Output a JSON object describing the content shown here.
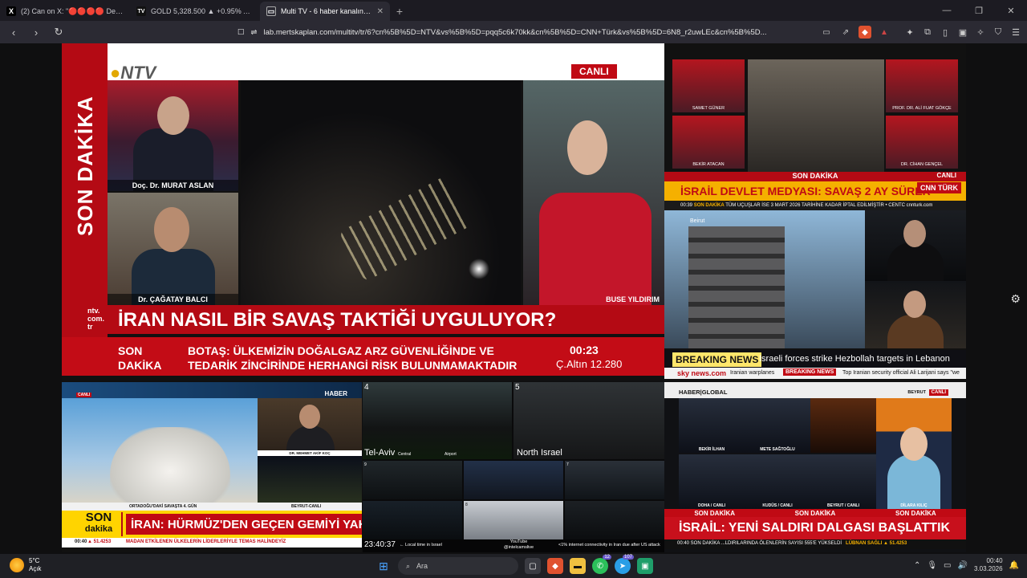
{
  "browser": {
    "tabs": [
      {
        "icon": "X",
        "icon_color": "#000000",
        "title": "(2) Can on X: \"🔴🔴🔴🔴 Devrim"
      },
      {
        "icon": "TV",
        "icon_color": "#1e1e1e",
        "title": "GOLD 5,328.500 ▲ +0.95% Adsız"
      },
      {
        "icon": "▭",
        "icon_color": "#2b2a33",
        "title": "Multi TV - 6 haber kanalını aynı"
      }
    ],
    "url": "lab.mertskaplan.com/multitv/tr/6?cn%5B%5D=NTV&vs%5B%5D=pqq5c6k70kk&cn%5B%5D=CNN+Türk&vs%5B%5D=6N8_r2uwLEc&cn%5B%5D..."
  },
  "ntv": {
    "logo": "NTV",
    "side": "SON DAKİKA",
    "live": "CANLI",
    "guest1": "Doç. Dr. MURAT ASLAN",
    "guest2": "Dr. ÇAĞATAY BALCI",
    "anchor": "BUSE YILDIRIM",
    "site": "ntv.\ncom.\ntr",
    "headline": "İRAN NASIL BİR SAVAŞ TAKTİĞİ UYGULUYOR?",
    "ticker_label": "SON\nDAKİKA",
    "ticker_news": "BOTAŞ: ÜLKEMİZİN DOĞALGAZ ARZ GÜVENLİĞİNDE VE\nTEDARİK ZİNCİRİNDE HERHANGİ RİSK BULUNMAMAKTADIR",
    "time": "00:23",
    "gold": "Ç.Altın 12.280"
  },
  "cnn": {
    "names": [
      "SAMET GÜNER",
      "PROF. DR. ALİ FUAT GÖKÇE",
      "BEKİR ATACAN",
      "DR. CİHAN GENÇEL"
    ],
    "son_dakika": "SON DAKİKA",
    "live": "CANLI",
    "headline": "İSRAİL DEVLET MEDYASI: SAVAŞ 2 AY SÜRER",
    "logo": "CNN TÜRK",
    "ticker_time": "00:39",
    "ticker_label": "SON DAKİKA",
    "ticker_text": "TÜM UÇUŞLAR İSE 3 MART 2026 TARİHİNE KADAR İPTAL EDİLMİŞTİR  •  CENTC  cnnturk.com"
  },
  "sky": {
    "location": "Beirut",
    "breaking": "BREAKING NEWS",
    "headline": "Israeli forces strike Hezbollah targets in Lebanon",
    "logo": "sky news.com",
    "t1": "Iranian warplanes",
    "breaking2": "BREAKING NEWS",
    "t2": "Top Iranian security official Ali Larijani says \"we"
  },
  "hg": {
    "logo": "HABER|GLOBAL",
    "location": "BEYRUT",
    "live": "CANLI",
    "cells": [
      "BEKİR İLHAN",
      "METE SAĞTOĞLU",
      "",
      "DİLARA KILIÇ",
      "DOHA / CANLI",
      "KUDÜS / CANLI",
      "BEYRUT / CANLI",
      ""
    ],
    "son_dakika": [
      "SON DAKİKA",
      "SON DAKİKA",
      "SON DAKİKA"
    ],
    "headline": "İSRAİL: YENİ SALDIRI DALGASI BAŞLATTIK",
    "ticker": "00:40  SON DAKİKA  ...LDIRILARINDA ÖLENLERİN SAYISI 555'E YÜKSELDİ",
    "ticker_right": "LÜBNAN SAĞLI  ▲ 51.4253"
  },
  "ht": {
    "logo": "HABER",
    "live": "CANLI",
    "guest": "DR. MEHMET AKİF KOÇ",
    "sub_left": "ORTADOĞU'DAKİ SAVAŞTA 4. GÜN",
    "sub_right": "BEYRUT-CANLI",
    "sd1": "SON",
    "sd2": "dakika",
    "headline": "İRAN: HÜRMÜZ'DEN GEÇEN GEMİYİ YAKARIZ",
    "tick_time": "00:40",
    "tick_gold": "▲ 51.4253",
    "tick_text": "MADAN ETKİLENEN ÜLKELERİN LİDERLERİYLE TEMAS HALİNDEYİZ"
  },
  "mc": {
    "c4": "4",
    "c5": "5",
    "tel": "Tel-Aviv",
    "central": "Central",
    "airport": "Airport",
    "north": "North Israel",
    "c9": "9",
    "c7": "7",
    "c8": "8",
    "clock": "23:40:37",
    "local": "← Local time in Israel",
    "yt": "YouTube\n@intelcamslive",
    "inet": "<1% internet connectivity in Iran due after US attack"
  },
  "taskbar": {
    "temp": "5°C",
    "cond": "Açık",
    "search": "Ara",
    "time": "00:40",
    "date": "3.03.2026"
  }
}
